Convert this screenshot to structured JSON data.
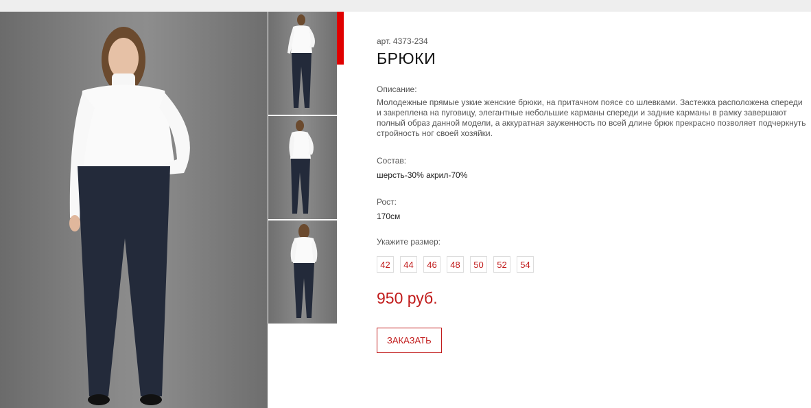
{
  "colors": {
    "accent": "#c11b1b",
    "active_marker": "#e00000",
    "photo_background": "#7d7d7d",
    "turtleneck": "#ffffff",
    "trousers": "#1f2535"
  },
  "gallery": {
    "main_image": "woman-in-white-turtleneck-navy-trousers-front-photo",
    "thumbnails": [
      "front-view-photo",
      "front-view-photo",
      "back-view-photo"
    ],
    "active_index": 0
  },
  "product": {
    "article": "арт. 4373-234",
    "title": "БРЮКИ",
    "description_label": "Описание:",
    "description": "Молодежные прямые узкие женские брюки, на притачном поясе со шлевками. Застежка расположена спереди и закреплена на пуговицу, элегантные небольшие карманы спереди и задние карманы в рамку завершают полный образ данной модели, а аккуратная зауженность по всей длине брюк прекрасно позволяет подчеркнуть стройность ног своей хозяйки.",
    "composition_label": "Состав:",
    "composition": "шерсть-30% акрил-70%",
    "height_label": "Рост:",
    "height": "170см",
    "size_label": "Укажите размер:",
    "sizes": [
      "42",
      "44",
      "46",
      "48",
      "50",
      "52",
      "54"
    ],
    "price": "950 руб.",
    "order_button": "ЗАКАЗАТЬ"
  }
}
